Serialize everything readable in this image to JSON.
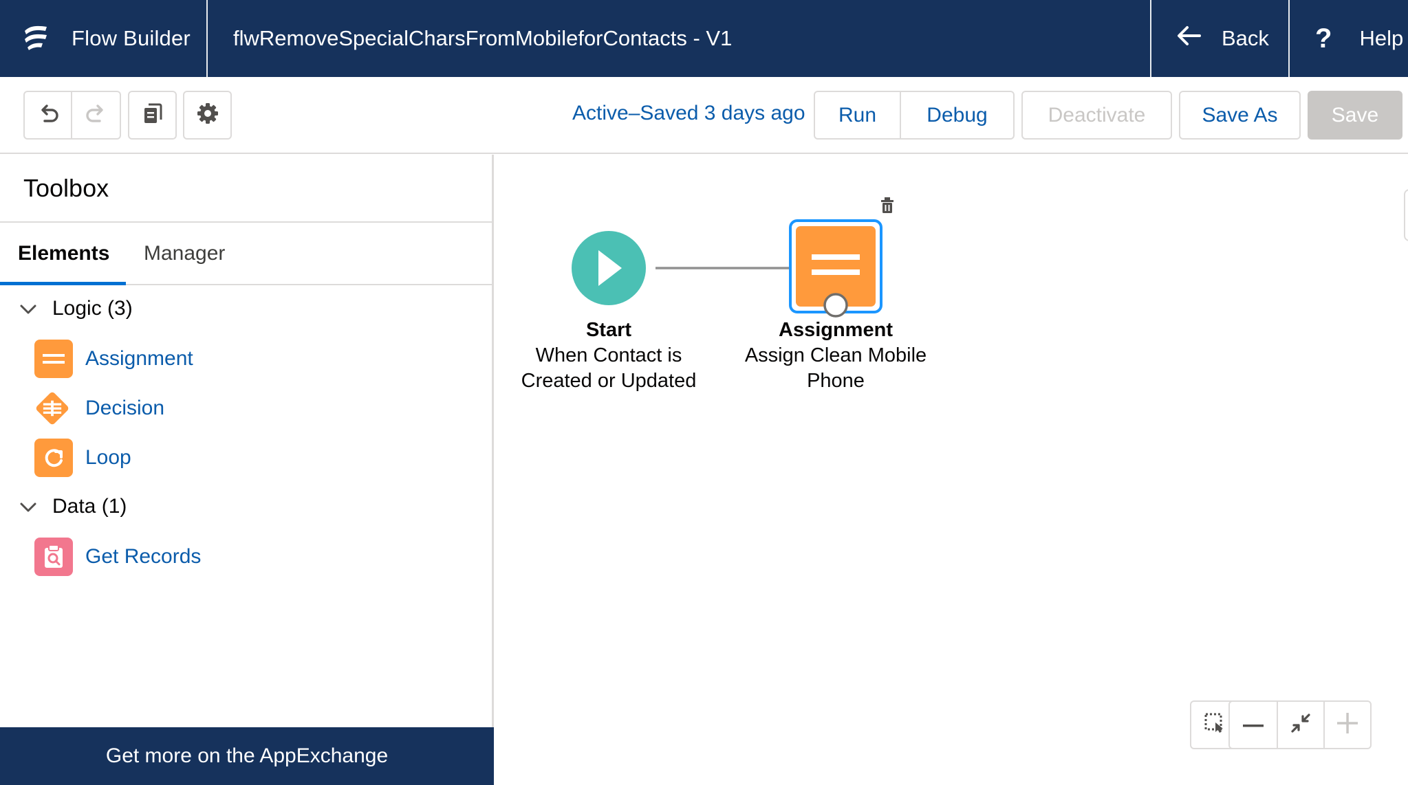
{
  "header": {
    "app_name": "Flow Builder",
    "flow_title": "flwRemoveSpecialCharsFromMobileforContacts - V1",
    "back_label": "Back",
    "help_label": "Help"
  },
  "toolbar": {
    "status": "Active–Saved 3 days ago",
    "run_label": "Run",
    "debug_label": "Debug",
    "deactivate_label": "Deactivate",
    "save_as_label": "Save As",
    "save_label": "Save"
  },
  "toolbox": {
    "title": "Toolbox",
    "tabs": [
      {
        "label": "Elements",
        "active": true
      },
      {
        "label": "Manager",
        "active": false
      }
    ],
    "sections": [
      {
        "label": "Logic (3)",
        "items": [
          {
            "label": "Assignment",
            "icon": "assignment-icon",
            "color": "#ff9a3c"
          },
          {
            "label": "Decision",
            "icon": "decision-icon",
            "color": "#ff9a3c"
          },
          {
            "label": "Loop",
            "icon": "loop-icon",
            "color": "#ff9a3c"
          }
        ]
      },
      {
        "label": "Data (1)",
        "items": [
          {
            "label": "Get Records",
            "icon": "get-records-icon",
            "color": "#f2778e"
          }
        ]
      }
    ],
    "appexchange_label": "Get more on the AppExchange"
  },
  "canvas": {
    "start_node": {
      "title": "Start",
      "line1": "When Contact is",
      "line2": "Created or Updated",
      "color": "#4bc0b4"
    },
    "assignment_node": {
      "title": "Assignment",
      "line1": "Assign Clean Mobile",
      "line2": "Phone",
      "color": "#ff9a3c",
      "selected": true
    }
  },
  "colors": {
    "header_bg": "#16325c",
    "link_blue": "#0b5cab",
    "selection_blue": "#1b96ff"
  }
}
